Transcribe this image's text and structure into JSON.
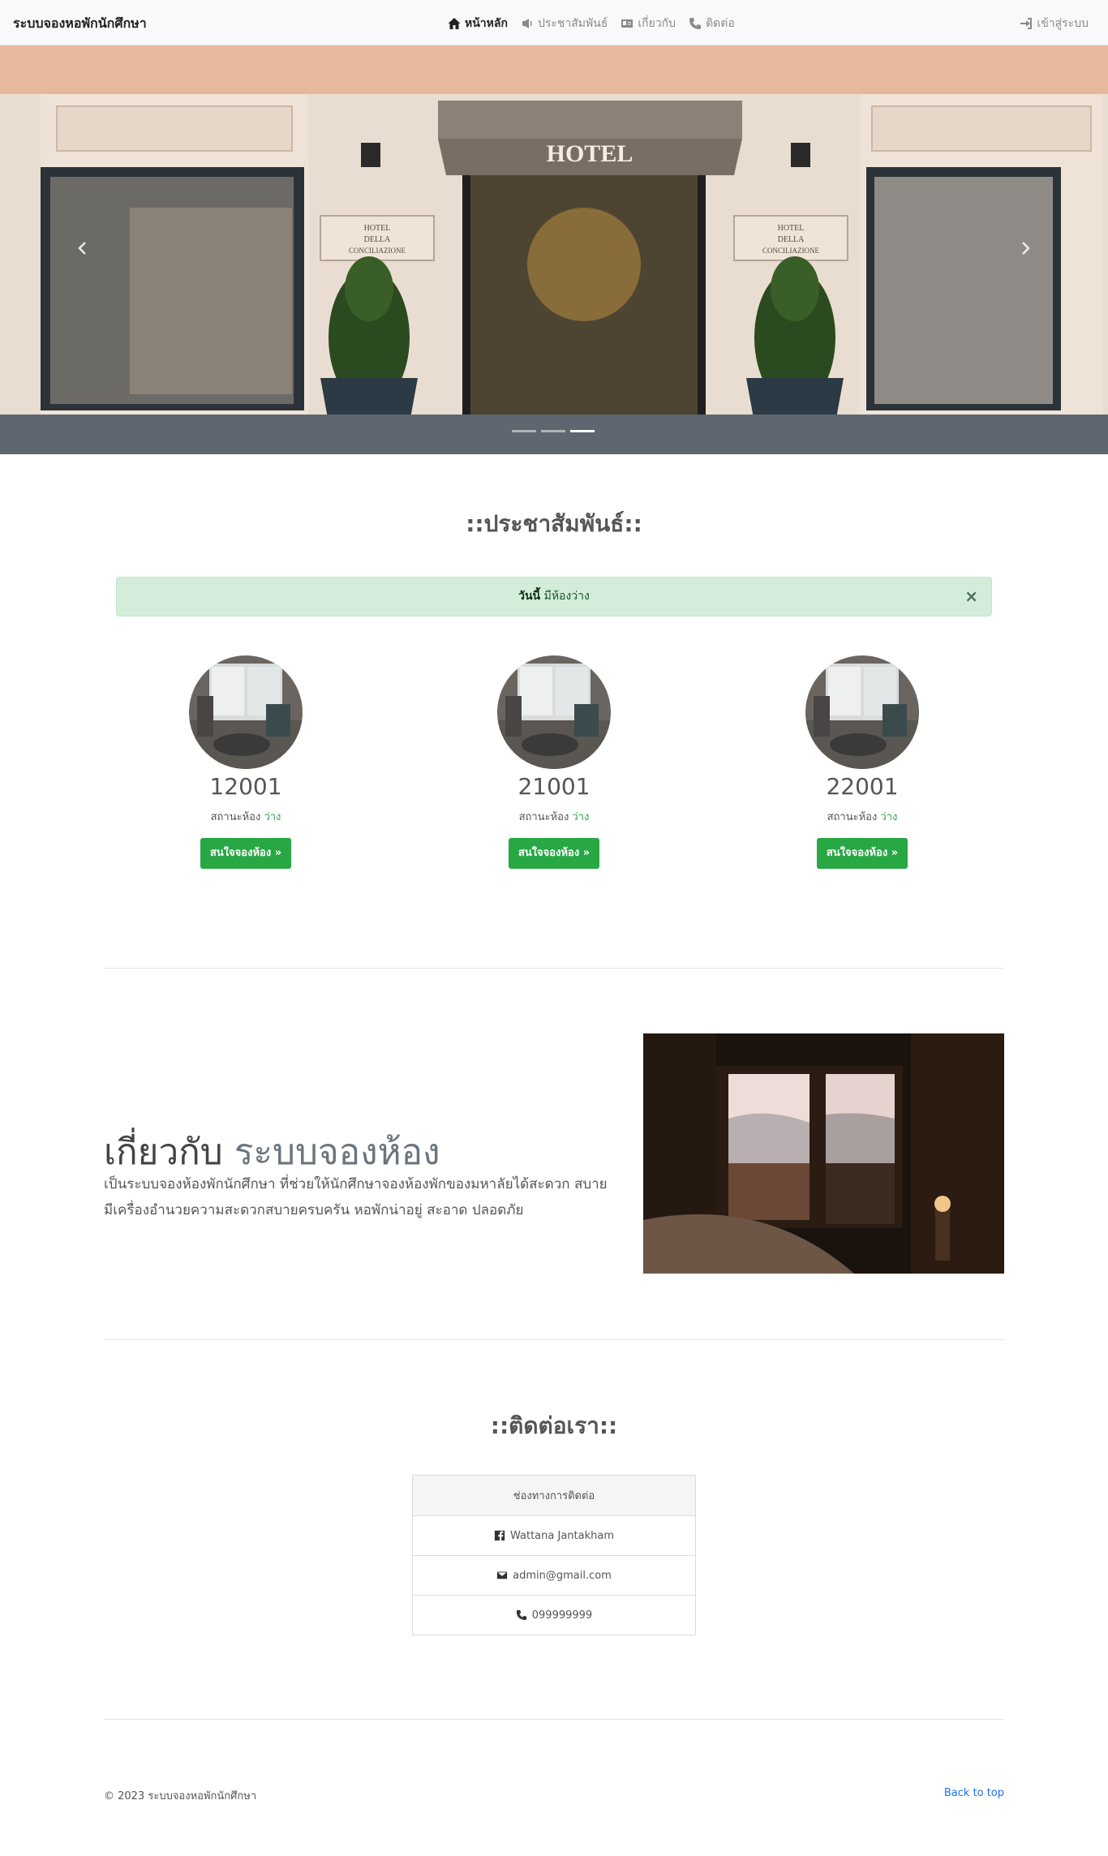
{
  "nav": {
    "brand": "ระบบจองหอพักนักศึกษา",
    "items": [
      {
        "label": "หน้าหลัก",
        "icon": "home-icon",
        "active": true
      },
      {
        "label": "ประชาสัมพันธ์",
        "icon": "megaphone-icon",
        "active": false
      },
      {
        "label": "เกี่ยวกับ",
        "icon": "id-card-icon",
        "active": false
      },
      {
        "label": "ติดต่อ",
        "icon": "phone-icon",
        "active": false
      }
    ],
    "login": "เข้าสู่ระบบ",
    "login_icon": "sign-in-icon"
  },
  "carousel": {
    "sign_text": "HOTEL",
    "plaque_text": [
      "HOTEL",
      "DELLA",
      "CONCILIAZIONE"
    ],
    "slides": 3,
    "active_slide": 3
  },
  "news": {
    "title": "::ประชาสัมพันธ์::",
    "alert_strong": "วันนี้",
    "alert_text": " มีห้องว่าง",
    "alert_close": "×",
    "status_label": "สถานะห้อง",
    "rooms": [
      {
        "number": "12001",
        "status": "ว่าง",
        "button": "สนใจจองห้อง »"
      },
      {
        "number": "21001",
        "status": "ว่าง",
        "button": "สนใจจองห้อง »"
      },
      {
        "number": "22001",
        "status": "ว่าง",
        "button": "สนใจจองห้อง »"
      }
    ]
  },
  "about": {
    "title_main": "เกี่ยวกับ",
    "title_muted": "ระบบจองห้อง",
    "text": "เป็นระบบจองห้องพักนักศึกษา ที่ช่วยให้นักศึกษาจองห้องพักของมหาลัยได้สะดวก สบาย มีเครื่องอำนวยความสะดวกสบายครบครัน หอพักน่าอยู่ สะอาด ปลอดภัย"
  },
  "contact": {
    "title": "::ติดต่อเรา::",
    "header": "ช่องทางการติดต่อ",
    "facebook": "Wattana Jantakham",
    "email": "admin@gmail.com",
    "phone": "099999999"
  },
  "footer": {
    "copyright": "© 2023 ระบบจองหอพักนักศึกษา",
    "back_to_top": "Back to top"
  },
  "colors": {
    "success": "#28a745",
    "alert_bg": "#d4edda",
    "link": "#1a73e8"
  }
}
